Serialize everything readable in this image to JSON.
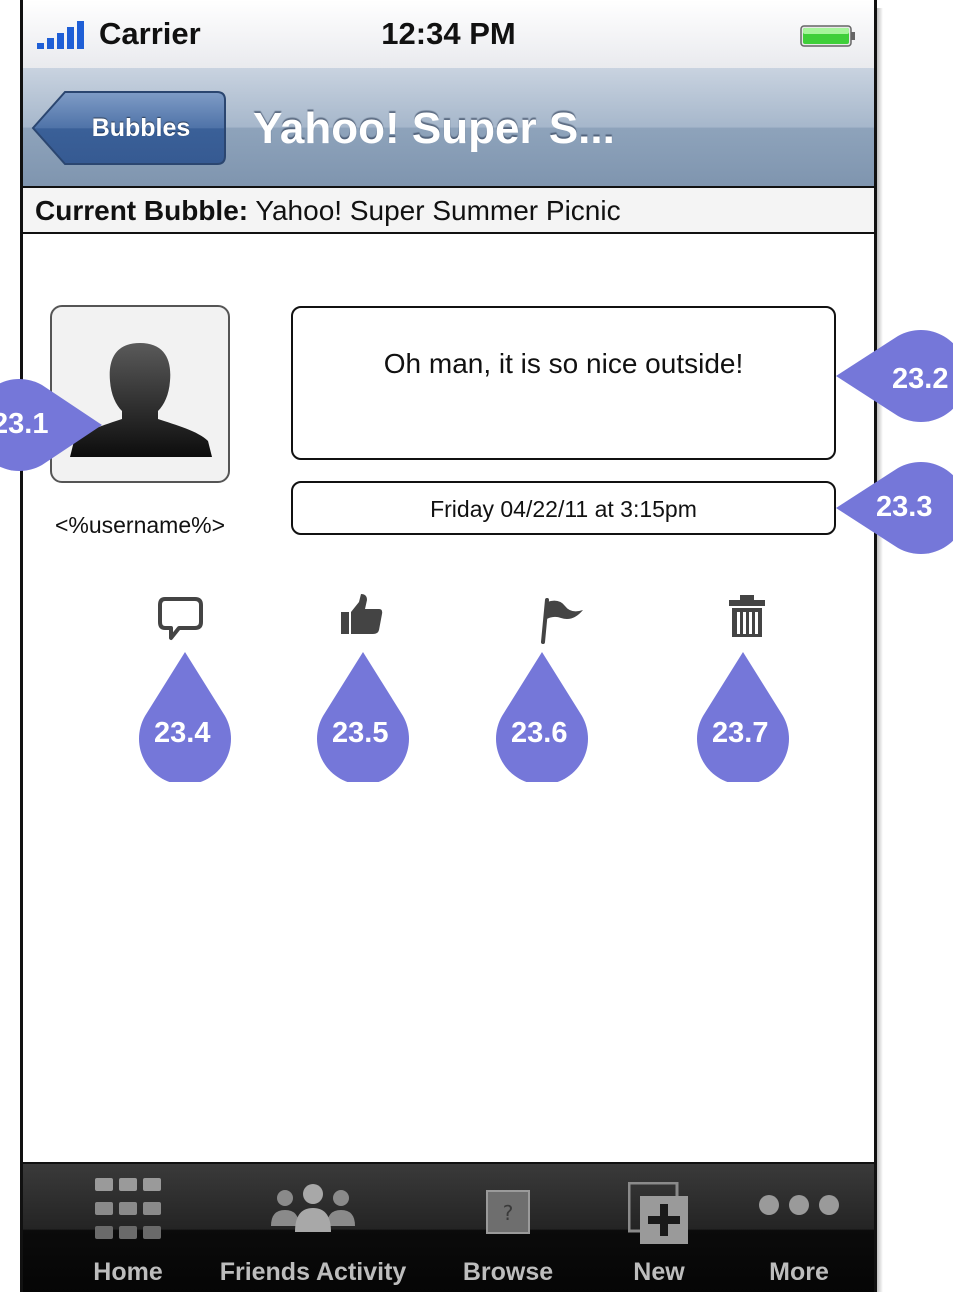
{
  "status_bar": {
    "carrier": "Carrier",
    "time": "12:34 PM"
  },
  "nav": {
    "back_label": "Bubbles",
    "title": "Yahoo! Super S..."
  },
  "current_bubble": {
    "label": "Current Bubble:",
    "value": "Yahoo! Super Summer Picnic"
  },
  "post": {
    "username": "<%username%>",
    "message": "Oh man, it is so nice outside!",
    "timestamp": "Friday 04/22/11 at 3:15pm"
  },
  "actions": [
    {
      "icon": "comment-icon"
    },
    {
      "icon": "thumbs-up-icon"
    },
    {
      "icon": "flag-icon"
    },
    {
      "icon": "trash-icon"
    }
  ],
  "annotations": {
    "a1": "23.1",
    "a2": "23.2",
    "a3": "23.3",
    "a4": "23.4",
    "a5": "23.5",
    "a6": "23.6",
    "a7": "23.7",
    "color": "#7577d9"
  },
  "tabs": [
    {
      "label": "Home",
      "icon": "grid-icon"
    },
    {
      "label": "Friends Activity",
      "icon": "people-icon"
    },
    {
      "label": "Browse",
      "icon": "browse-icon"
    },
    {
      "label": "New",
      "icon": "new-plus-icon"
    },
    {
      "label": "More",
      "icon": "more-dots-icon"
    }
  ],
  "colors": {
    "nav_blue": "#8ea3bb",
    "tab_bg": "#0b0b0b",
    "accent": "#7577d9",
    "battery_green": "#3fcf3a"
  }
}
